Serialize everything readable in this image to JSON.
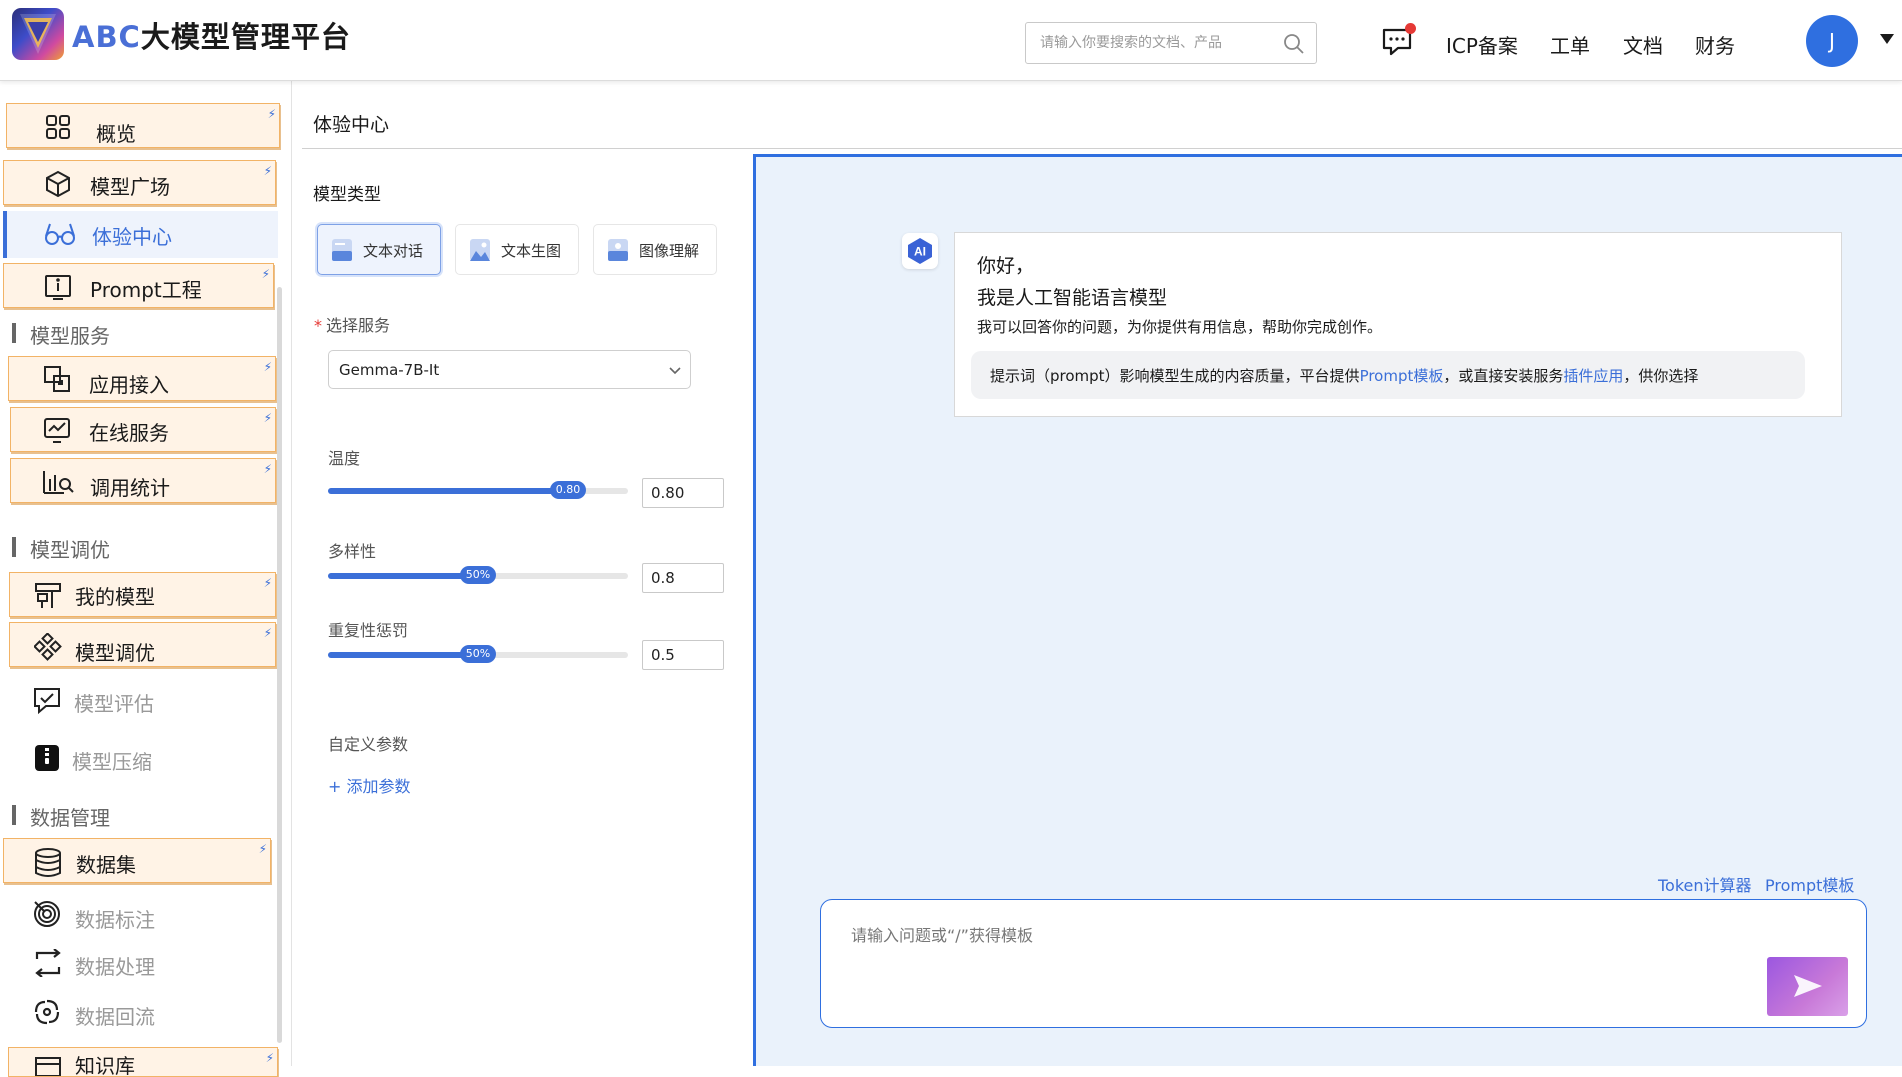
{
  "header": {
    "brand_prefix": "ABC",
    "brand_suffix": "大模型管理平台",
    "search_placeholder": "请输入你要搜索的文档、产品",
    "nav": [
      "ICP备案",
      "工单",
      "文档",
      "财务"
    ],
    "avatar_initial": "J"
  },
  "sidebar": {
    "overview": "概览",
    "model_plaza": "模型广场",
    "experience_center": "体验中心",
    "prompt_engineering": "Prompt工程",
    "section_model_service": "模型服务",
    "app_access": "应用接入",
    "online_service": "在线服务",
    "call_stats": "调用统计",
    "section_model_tuning": "模型调优",
    "my_models": "我的模型",
    "model_tuning": "模型调优",
    "model_evaluation": "模型评估",
    "model_compression": "模型压缩",
    "section_data_mgmt": "数据管理",
    "dataset": "数据集",
    "data_labeling": "数据标注",
    "data_processing": "数据处理",
    "data_backflow": "数据回流",
    "knowledge_base": "知识库"
  },
  "config": {
    "title": "体验中心",
    "model_type_label": "模型类型",
    "types": [
      "文本对话",
      "文本生图",
      "图像理解"
    ],
    "select_service_label": "选择服务",
    "service_value": "Gemma-7B-It",
    "temperature": {
      "label": "温度",
      "value": 0.8,
      "badge": "0.80",
      "input": "0.80"
    },
    "diversity": {
      "label": "多样性",
      "value": 0.5,
      "badge": "50%",
      "input": "0.8"
    },
    "repetition_penalty": {
      "label": "重复性惩罚",
      "value": 0.5,
      "badge": "50%",
      "input": "0.5"
    },
    "custom_params_label": "自定义参数",
    "add_param": "+ 添加参数"
  },
  "chat": {
    "ai_badge": "AI",
    "greeting_1": "你好，",
    "greeting_2": "我是人工智能语言模型",
    "intro": "我可以回答你的问题，为你提供有用信息，帮助你完成创作。",
    "tip_1": "提示词（prompt）影响模型生成的内容质量，平台提供",
    "tip_link_1": "Prompt模板",
    "tip_2": "，或直接安装服务",
    "tip_link_2": "插件应用",
    "tip_3": "，供你选择",
    "tool_1": "Token计算器",
    "tool_2": "Prompt模板",
    "input_placeholder": "请输入问题或“/”获得模板"
  },
  "colors": {
    "accent": "#3b6fd8",
    "highlight_bg": "#fff3e6",
    "highlight_border": "#f2b366",
    "chat_bg": "#eaf2fb",
    "send_gradient": "#9b57e0"
  }
}
